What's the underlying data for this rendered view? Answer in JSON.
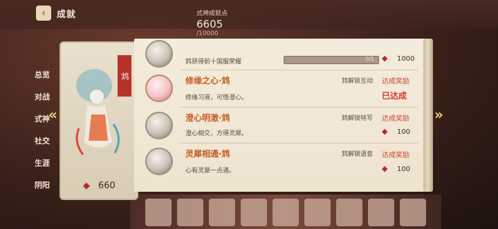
{
  "header": {
    "title": "成就",
    "points_label": "式神成就点",
    "points_value": "6605",
    "points_max": "/10000"
  },
  "left_tabs": [
    "总览",
    "对战",
    "式神",
    "社交",
    "生涯",
    "阴阳"
  ],
  "card": {
    "tag": "鸩",
    "gem_icon": "magatama-icon",
    "gem_count": "660"
  },
  "top_item": {
    "desc": "鸩获得前十国服荣耀",
    "progress_text": "0/1",
    "progress": 0.0,
    "reward": "1000"
  },
  "items": [
    {
      "title": "修缘之心·鸩",
      "desc": "修缘习道，可悟澄心。",
      "unlock": "鸩解锁互动",
      "status": "达成奖励",
      "done": "已达成",
      "reward": ""
    },
    {
      "title": "澄心明澈·鸩",
      "desc": "澄心相交，方得灵犀。",
      "unlock": "鸩解锁特写",
      "status": "达成奖励",
      "done": "",
      "reward": "100"
    },
    {
      "title": "灵犀相通·鸩",
      "desc": "心有灵犀一点通。",
      "unlock": "鸩解锁语音",
      "status": "达成奖励",
      "done": "",
      "reward": "100"
    }
  ],
  "colors": {
    "accent": "#c55e28",
    "status_red": "#c84a33",
    "parchment": "#f4ecdc"
  }
}
